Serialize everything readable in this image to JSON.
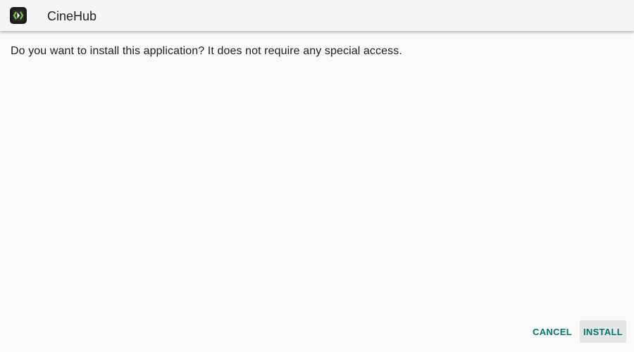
{
  "app": {
    "title": "CineHub",
    "icon": "cinehub-app-icon",
    "icon_colors": {
      "background": "#1b1d1b",
      "accent": "#7cc242"
    }
  },
  "dialog": {
    "message": "Do you want to install this application? It does not require any special access."
  },
  "actions": {
    "cancel_label": "CANCEL",
    "install_label": "INSTALL"
  },
  "colors": {
    "accent": "#00796b",
    "background": "#fafafa",
    "header": "#f5f5f5",
    "text": "#212121"
  }
}
